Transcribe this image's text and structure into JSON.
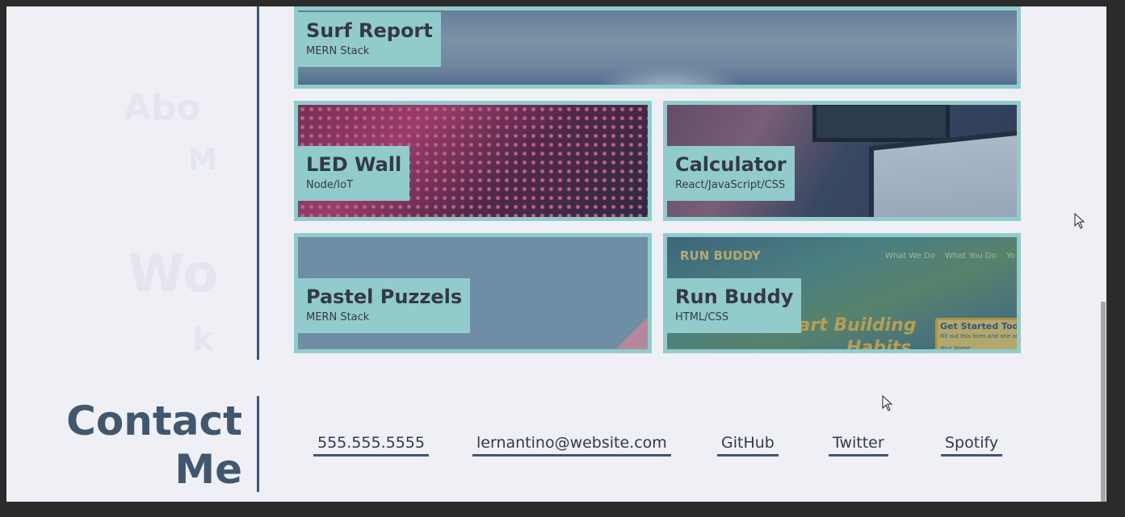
{
  "projects": [
    {
      "title": "Surf Report",
      "stack": "MERN Stack"
    },
    {
      "title": "LED Wall",
      "stack": "Node/IoT"
    },
    {
      "title": "Calculator",
      "stack": "React/JavaScript/CSS"
    },
    {
      "title": "Pastel Puzzels",
      "stack": "MERN Stack"
    },
    {
      "title": "Run Buddy",
      "stack": "HTML/CSS"
    }
  ],
  "run_buddy_preview": {
    "brand": "RUN BUDDY",
    "nav": [
      "What We Do",
      "What You Do",
      "Yo"
    ],
    "hero_line1": "tart Building",
    "hero_line2": "Habits",
    "form_title": "Get Started Today",
    "form_text": "Fill out this form and one of o",
    "form_field": "Your Name"
  },
  "contact": {
    "title_line1": "Contact",
    "title_line2": "Me",
    "links": [
      {
        "label": "555.555.5555"
      },
      {
        "label": "lernantino@website.com"
      },
      {
        "label": "GitHub"
      },
      {
        "label": "Twitter"
      },
      {
        "label": "Spotify"
      }
    ]
  },
  "colors": {
    "accent": "#92cbcc",
    "heading": "#415770",
    "text": "#343a44",
    "background": "#efeff6"
  }
}
